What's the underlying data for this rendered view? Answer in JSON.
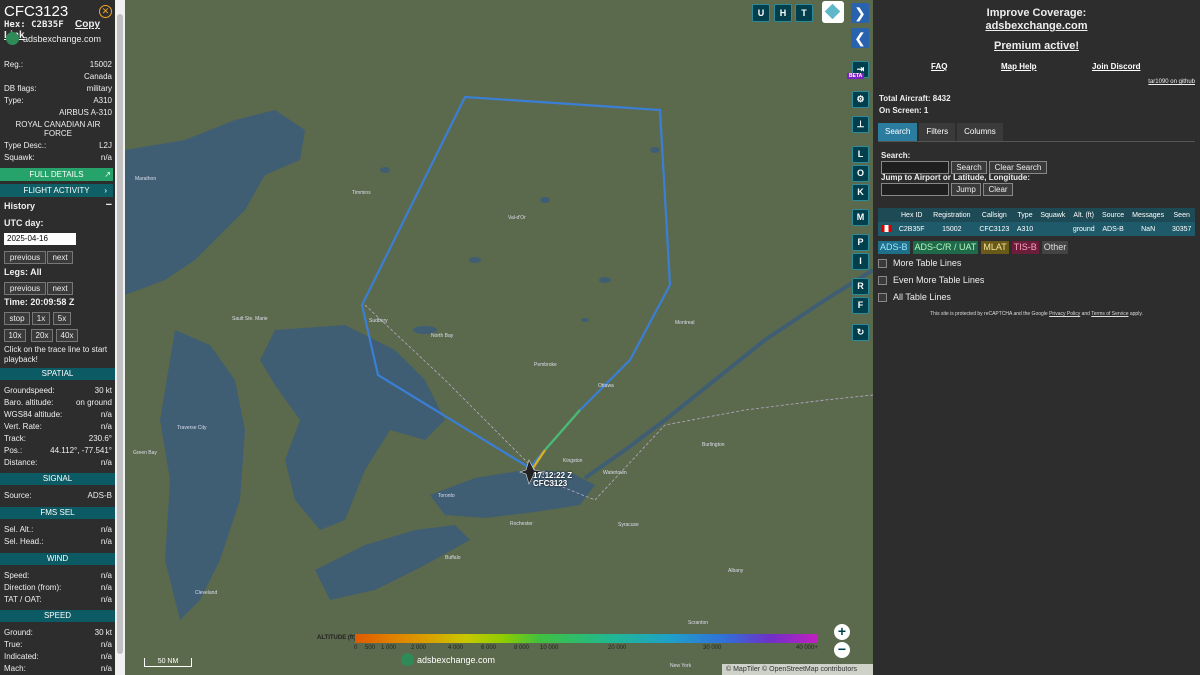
{
  "aircraft": {
    "callsign": "CFC3123",
    "hex_label": "Hex:",
    "hex": "C2B35F",
    "copy_link": "Copy Link",
    "site": "adsbexchange.com",
    "reg_label": "Reg.:",
    "reg": "15002",
    "country": "Canada",
    "dbflags_label": "DB flags:",
    "dbflags": "military",
    "type_label": "Type:",
    "type": "A310",
    "model": "AIRBUS A-310",
    "operator": "ROYAL CANADIAN AIR FORCE",
    "typedesc_label": "Type Desc.:",
    "typedesc": "L2J",
    "squawk_label": "Squawk:",
    "squawk": "n/a"
  },
  "buttons": {
    "full_details": "FULL DETAILS",
    "flight_activity": "FLIGHT ACTIVITY",
    "arrow_right": "›"
  },
  "history": {
    "title": "History",
    "collapse": "−",
    "utc_day_label": "UTC day:",
    "date": "2025-04-16",
    "previous": "previous",
    "next": "next",
    "legs": "Legs: All",
    "time": "Time: 20:09:58 Z",
    "stop": "stop",
    "s1": "1x",
    "s5": "5x",
    "s10": "10x",
    "s20": "20x",
    "s40": "40x",
    "hint": "Click on the trace line to start playback!"
  },
  "spatial": {
    "title": "SPATIAL",
    "groundspeed_label": "Groundspeed:",
    "groundspeed": "30 kt",
    "baro_label": "Baro. altitude:",
    "baro": "on ground",
    "wgs_label": "WGS84 altitude:",
    "wgs": "n/a",
    "vert_label": "Vert. Rate:",
    "vert": "n/a",
    "track_label": "Track:",
    "track": "230.6°",
    "pos_label": "Pos.:",
    "pos": "44.112°, -77.541°",
    "dist_label": "Distance:",
    "dist": "n/a"
  },
  "signal": {
    "title": "SIGNAL",
    "source_label": "Source:",
    "source": "ADS-B"
  },
  "fms": {
    "title": "FMS SEL",
    "alt_label": "Sel. Alt.:",
    "alt": "n/a",
    "head_label": "Sel. Head.:",
    "head": "n/a"
  },
  "wind": {
    "title": "WIND",
    "speed_label": "Speed:",
    "speed": "n/a",
    "dir_label": "Direction (from):",
    "dir": "n/a",
    "tat_label": "TAT / OAT:",
    "tat": "n/a"
  },
  "speed": {
    "title": "SPEED",
    "ground_label": "Ground:",
    "ground": "30 kt",
    "true_label": "True:",
    "true": "n/a",
    "ind_label": "Indicated:",
    "ind": "n/a",
    "mach_label": "Mach:",
    "mach": "n/a"
  },
  "map": {
    "top_buttons": [
      "U",
      "H",
      "T"
    ],
    "side_buttons": [
      "L",
      "O",
      "K",
      "M",
      "P",
      "I",
      "R",
      "F"
    ],
    "beta": "BETA",
    "zoom_in": "+",
    "zoom_out": "−",
    "scale": "50 NM",
    "attribution": "© MapTiler © OpenStreetMap contributors",
    "altitude_title": "ALTITUDE (ft)",
    "altitude_ticks": [
      "0",
      "500",
      "1 000",
      "2 000",
      "4 000",
      "6 000",
      "8 000",
      "10 000",
      "20 000",
      "30 000",
      "40 000+"
    ],
    "brand": "adsbexchange.com",
    "aircraft_label_time": "17:12:22 Z",
    "aircraft_label_call": "CFC3123",
    "places": [
      "Marathon",
      "Timmins",
      "Val-d'Or",
      "Sudbury",
      "North Bay",
      "Sault Ste. Marie",
      "Pembroke",
      "Ottawa",
      "Kingston",
      "Toronto",
      "Rochester",
      "Buffalo",
      "Montreal",
      "Syracuse",
      "Watertown",
      "Burlington",
      "Albany",
      "Scranton",
      "Cleveland",
      "Traverse City",
      "Green Bay",
      "New York"
    ]
  },
  "right": {
    "improve": "Improve Coverage:",
    "site": "adsbexchange.com",
    "premium": "Premium active!",
    "faq": "FAQ",
    "map_help": "Map Help",
    "discord": "Join Discord",
    "github": "tar1090 on github",
    "total": "Total Aircraft: 8432",
    "onscreen": "On Screen: 1",
    "tabs": [
      "Search",
      "Filters",
      "Columns"
    ],
    "search_label": "Search:",
    "search_btn": "Search",
    "clear_search": "Clear Search",
    "jump_label": "Jump to Airport or Latitude, Longitude:",
    "jump_btn": "Jump",
    "clear_btn": "Clear",
    "columns": [
      "",
      "Hex ID",
      "Registration",
      "Callsign",
      "Type",
      "Squawk",
      "Alt. (ft)",
      "Source",
      "Messages",
      "Seen"
    ],
    "row": [
      "",
      "C2B35F",
      "15002",
      "CFC3123",
      "A310",
      "",
      "ground",
      "ADS-B",
      "NaN",
      "30357"
    ],
    "tags": [
      "ADS-B",
      "ADS-C/R / UAT",
      "MLAT",
      "TIS-B",
      "Other"
    ],
    "more_lines": "More Table Lines",
    "even_more": "Even More Table Lines",
    "all_lines": "All Table Lines",
    "recaptcha_a": "This site is protected by reCAPTCHA and the Google",
    "privacy": "Privacy Policy",
    "and": "and",
    "terms": "Terms of Service",
    "apply": "apply."
  },
  "colors": {
    "accent": "#26a36a",
    "section": "#0c5a63",
    "trace": "#3a7fd5",
    "map": "#5b6a4c",
    "water": "#3f5e74"
  }
}
